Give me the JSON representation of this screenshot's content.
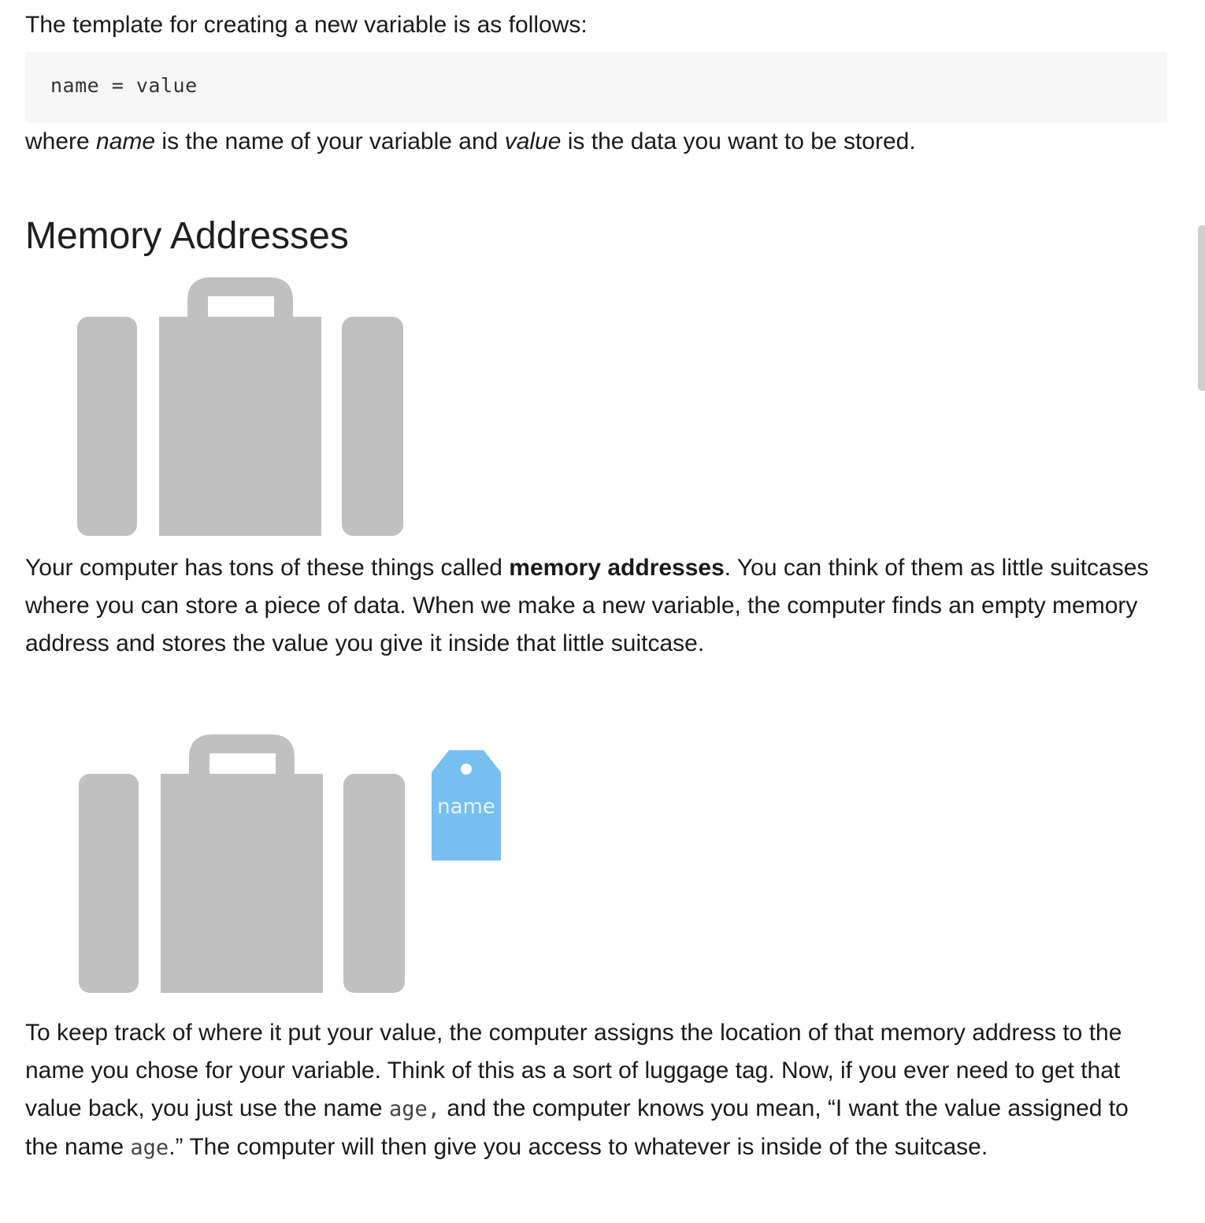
{
  "intro": "The template for creating a new variable is as follows:",
  "code_template": "name = value",
  "where": {
    "t1": "where ",
    "name": "name",
    "t2": " is the name of your variable and ",
    "value": "value",
    "t3": " is the data you want to be stored."
  },
  "heading": "Memory Addresses",
  "memory_paragraph": {
    "t1": "Your computer has tons of these things called ",
    "bold": "memory addresses",
    "t2": ". You can think of them as little suitcases where you can store a piece of data. When we make a new variable, the computer finds an empty memory address and stores the value you give it inside that little suitcase."
  },
  "tag_label": "name",
  "track_paragraph": {
    "t1": "To keep track of where it put your value, the computer assigns the location of that memory address to the name you chose for your variable. Think of this as a sort of luggage tag. Now, if you ever need to get that value back, you just use the name ",
    "code1": "age,",
    "t2": " and the computer knows you mean, “I want the value assigned to the name ",
    "code2": "age",
    "t3": ".” The computer will then give you access to whatever is inside of the suitcase."
  },
  "colors": {
    "suitcase": "#c0c0c0",
    "tag": "#76bff0"
  }
}
